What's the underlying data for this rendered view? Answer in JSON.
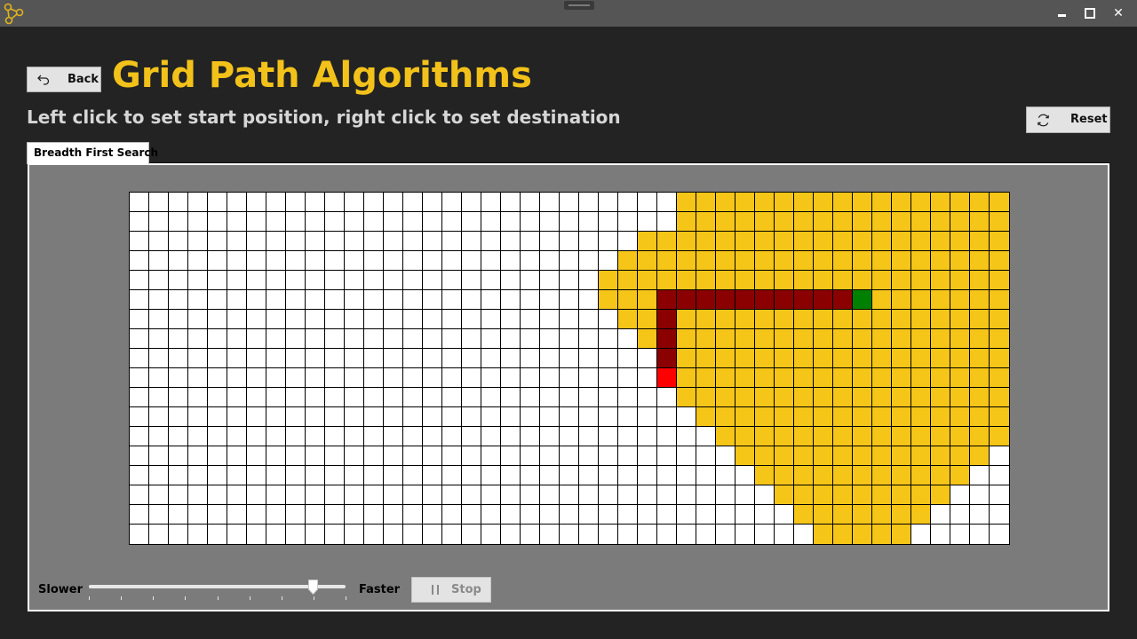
{
  "window": {
    "app_icon": "graph-network-icon",
    "controls": {
      "minimize_icon": "minimize-icon",
      "maximize_icon": "maximize-icon",
      "close_label": "✕"
    }
  },
  "header": {
    "back_label": "Back",
    "back_icon": "undo-arrow-icon",
    "title": "Grid Path Algorithms",
    "subtitle": "Left click to set start position, right click to set destination",
    "reset_label": "Reset",
    "reset_icon": "refresh-icon"
  },
  "tabs": [
    {
      "label": "Breadth First Search",
      "selected": true
    }
  ],
  "grid": {
    "cols": 45,
    "rows": 18,
    "colors": {
      "empty": "#ffffff",
      "visited": "#f5c518",
      "path": "#8b0000",
      "start": "#ff0000",
      "destination": "#008000",
      "lines": "#000000"
    },
    "visited_runs": [
      [
        28,
        44
      ],
      [
        28,
        44
      ],
      [
        26,
        44
      ],
      [
        25,
        44
      ],
      [
        24,
        44
      ],
      [
        24,
        44
      ],
      [
        25,
        44
      ],
      [
        26,
        44
      ],
      [
        27,
        44
      ],
      [
        28,
        44
      ],
      [
        28,
        44
      ],
      [
        29,
        44
      ],
      [
        30,
        44
      ],
      [
        31,
        43
      ],
      [
        32,
        42
      ],
      [
        33,
        41
      ],
      [
        34,
        40
      ],
      [
        35,
        39
      ]
    ],
    "path_cells": [
      [
        27,
        5
      ],
      [
        28,
        5
      ],
      [
        29,
        5
      ],
      [
        30,
        5
      ],
      [
        31,
        5
      ],
      [
        32,
        5
      ],
      [
        33,
        5
      ],
      [
        34,
        5
      ],
      [
        35,
        5
      ],
      [
        36,
        5
      ],
      [
        27,
        6
      ],
      [
        27,
        7
      ],
      [
        27,
        8
      ]
    ],
    "start": [
      27,
      9
    ],
    "destination": [
      37,
      5
    ]
  },
  "controls": {
    "slower_label": "Slower",
    "faster_label": "Faster",
    "speed": 0.875,
    "ticks": 9,
    "stop_label": "Stop",
    "stop_icon": "pause-icon",
    "stop_enabled": false
  }
}
